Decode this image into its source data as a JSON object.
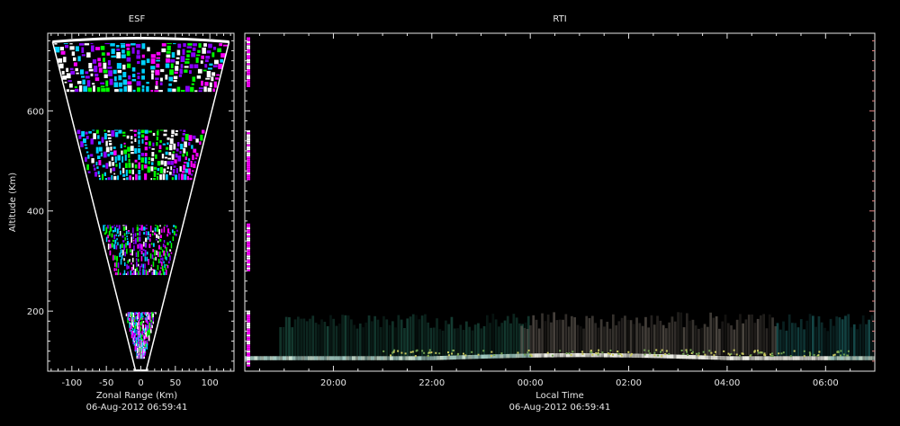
{
  "chart_data": [
    {
      "type": "scatter",
      "title": "ESF",
      "xlabel": "Zonal Range (Km)",
      "ylabel": "Altitude (Km)",
      "footer": "06-Aug-2012 06:59:41",
      "xlim": [
        -135,
        135
      ],
      "ylim": [
        80,
        755
      ],
      "x_ticks": [
        -100,
        -50,
        0,
        50,
        100
      ],
      "x_tick_labels": [
        "-100",
        "-50",
        "0",
        "50",
        "100"
      ],
      "y_ticks": [
        200,
        400,
        600
      ],
      "y_tick_labels": [
        "200",
        "400",
        "600"
      ],
      "cone": {
        "apex_altitude": 82,
        "rim_altitude": 738,
        "half_width_at_rim": 128
      },
      "echo_layers": [
        {
          "from_altitude": 105,
          "to_altitude": 198
        },
        {
          "from_altitude": 272,
          "to_altitude": 372
        },
        {
          "from_altitude": 462,
          "to_altitude": 562
        },
        {
          "from_altitude": 638,
          "to_altitude": 735
        }
      ],
      "colors": [
        "#ff00ff",
        "#00ff00",
        "#ffffff",
        "#8a00ff",
        "#00d0ff"
      ]
    },
    {
      "type": "heatmap",
      "title": "RTI",
      "xlabel": "Local Time",
      "footer": "06-Aug-2012 06:59:41",
      "xlim": [
        18.2,
        31.0
      ],
      "ylim": [
        80,
        755
      ],
      "x_ticks": [
        20,
        22,
        24,
        26,
        28,
        30
      ],
      "x_tick_labels": [
        "20:00",
        "22:00",
        "00:00",
        "02:00",
        "04:00",
        "06:00"
      ],
      "y_ticks": [
        200,
        400,
        600
      ],
      "bands": [
        {
          "start": 18.2,
          "end": 31.0,
          "base_altitude": 102,
          "top_altitude": 118,
          "color": "#d8d8c8"
        },
        {
          "start": 18.9,
          "end": 24.0,
          "base_altitude": 110,
          "top_altitude": 195,
          "color": "#1e5a4a"
        },
        {
          "start": 23.8,
          "end": 29.0,
          "base_altitude": 112,
          "top_altitude": 198,
          "color": "#6a625a"
        },
        {
          "start": 29.0,
          "end": 31.0,
          "base_altitude": 110,
          "top_altitude": 195,
          "color": "#1e6a6a"
        }
      ]
    }
  ]
}
